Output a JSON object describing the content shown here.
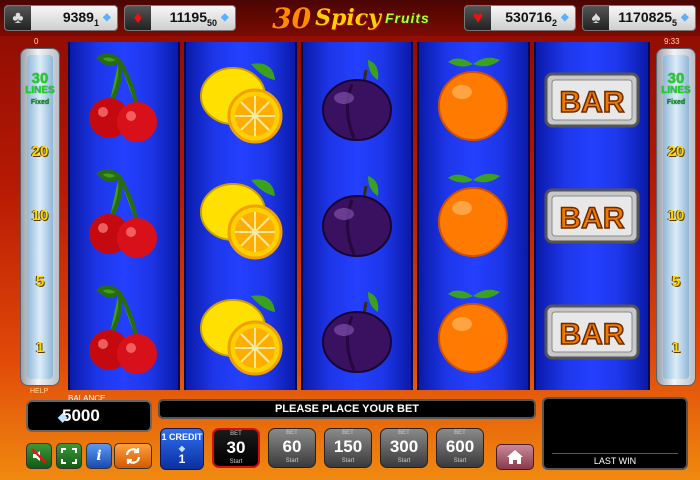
{
  "jackpots": [
    {
      "suit": "♣",
      "amount": "9389",
      "sub": "1"
    },
    {
      "suit": "♦",
      "amount": "11195",
      "sub": "50"
    },
    {
      "suit": "♥",
      "amount": "530716",
      "sub": "2"
    },
    {
      "suit": "♠",
      "amount": "1170825",
      "sub": "5"
    }
  ],
  "title": {
    "number": "30",
    "word1": "Spicy",
    "word2": "Fruits"
  },
  "corner_left": "0",
  "clock": "9:33",
  "lines_indicator": {
    "count": "30",
    "label": "LINES",
    "sub": "Fixed",
    "marks": [
      "20",
      "10",
      "5",
      "1"
    ]
  },
  "reels": [
    [
      "cherry",
      "cherry",
      "cherry"
    ],
    [
      "lemon",
      "lemon",
      "lemon"
    ],
    [
      "plum",
      "plum",
      "plum"
    ],
    [
      "orange",
      "orange",
      "orange"
    ],
    [
      "bar",
      "bar",
      "bar"
    ]
  ],
  "bar_text": "BAR",
  "help_label": "HELP",
  "balance": {
    "label": "BALANCE",
    "value": "5000"
  },
  "message": "PLEASE PLACE YOUR BET",
  "last_win": {
    "label": "LAST WIN"
  },
  "credit": {
    "label": "1 CREDIT",
    "value": "1"
  },
  "bets": {
    "tiny_top": "BET",
    "tiny_bottom": "Start",
    "values": [
      "30",
      "60",
      "150",
      "300",
      "600"
    ],
    "selected": "30"
  },
  "icons": {
    "sound": "speaker-muted-icon",
    "fullscreen": "fullscreen-icon",
    "info": "info-icon",
    "autoplay": "autoplay-icon",
    "home": "home-icon"
  },
  "colors": {
    "accent": "#1fd21f",
    "reel_blue": "#2440ff",
    "bet_active_border": "#d01010"
  }
}
